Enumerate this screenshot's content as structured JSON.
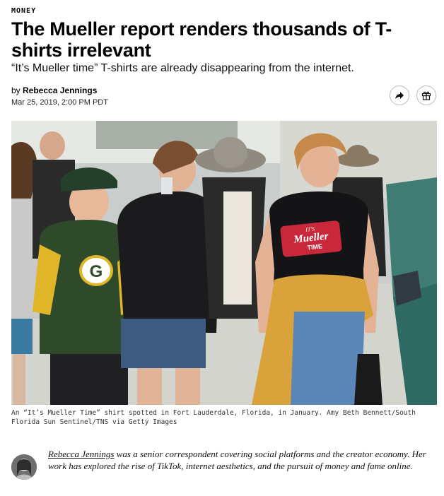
{
  "article": {
    "section": "MONEY",
    "headline": "The Mueller report renders thousands of T-shirts irrelevant",
    "dek": "“It’s Mueller time” T-shirts are already disappearing from the internet.",
    "byline_prefix": "by ",
    "author": "Rebecca Jennings",
    "date": "Mar 25, 2019, 2:00 PM PDT"
  },
  "actions": {
    "share_icon": "share-arrow-icon",
    "gift_icon": "gift-icon"
  },
  "photo": {
    "shirt_text_top": "IT'S",
    "shirt_text_middle": "Mueller",
    "shirt_text_bottom": "TIME",
    "hoodie_logo": "G",
    "caption": "An “It’s Mueller Time” shirt spotted in Fort Lauderdale, Florida, in January. Amy Beth Bennett/South Florida Sun Sentinel/TNS via Getty Images"
  },
  "bio": {
    "name": "Rebecca Jennings",
    "text": " was a senior correspondent covering social platforms and the creator economy. Her work has explored the rise of TikTok, internet aesthetics, and the pursuit of money and fame online."
  },
  "colors": {
    "shirt_red": "#c8283a",
    "hoodie_green": "#2f4a2b",
    "hoodie_yellow": "#e0b628",
    "sweater_mustard": "#d9a23a"
  }
}
